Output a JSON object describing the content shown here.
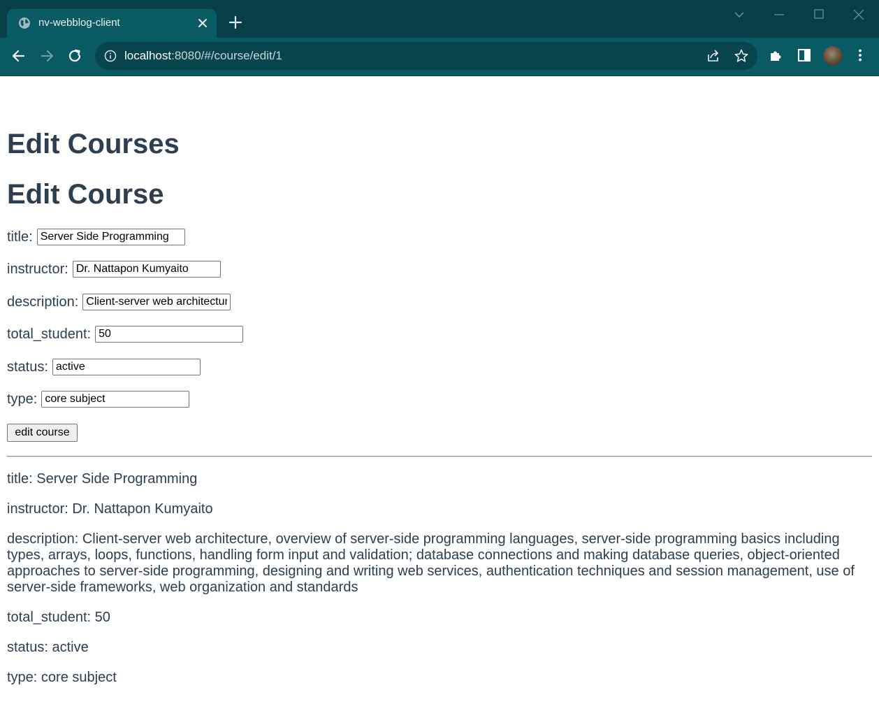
{
  "browser": {
    "tab_title": "nv-webblog-client",
    "url_host": "localhost",
    "url_rest": ":8080/#/course/edit/1"
  },
  "page": {
    "heading_main": "Edit Courses",
    "heading_sub": "Edit Course",
    "form": {
      "title_label": "title:",
      "title_value": "Server Side Programming",
      "instructor_label": "instructor:",
      "instructor_value": "Dr. Nattapon Kumyaito",
      "description_label": "description:",
      "description_value": "Client-server web architecture, overview of server-side programming languages, server-side programming basics including types, arrays, loops, functions, handling form input and validation; database connections and making database queries, object-oriented approaches to server-side programming, designing and writing web services, authentication techniques and session management, use of server-side frameworks, web organization and standards",
      "total_student_label": "total_student:",
      "total_student_value": "50",
      "status_label": "status:",
      "status_value": "active",
      "type_label": "type:",
      "type_value": "core subject",
      "submit_label": "edit course"
    },
    "details": {
      "title": "title: Server Side Programming",
      "instructor": "instructor: Dr. Nattapon Kumyaito",
      "description": "description: Client-server web architecture, overview of server-side programming languages, server-side programming basics including types, arrays, loops, functions, handling form input and validation; database connections and making database queries, object-oriented approaches to server-side programming, designing and writing web services, authentication techniques and session management, use of server-side frameworks, web organization and standards",
      "total_student": "total_student: 50",
      "status": "status: active",
      "type": "type: core subject"
    }
  },
  "colors": {
    "chrome_dark": "#073f47",
    "chrome_toolbar": "#0a5a63",
    "text": "#2c3e50"
  },
  "icons": {
    "tab": [
      "globe-icon",
      "close-icon",
      "plus-icon"
    ],
    "window": [
      "chevron-down-icon",
      "minimize-icon",
      "maximize-icon",
      "close-icon"
    ],
    "toolbar": [
      "back-arrow-icon",
      "forward-arrow-icon",
      "reload-icon",
      "info-icon",
      "share-icon",
      "star-icon",
      "puzzle-icon",
      "side-panel-icon",
      "avatar",
      "more-vert-icon"
    ]
  }
}
